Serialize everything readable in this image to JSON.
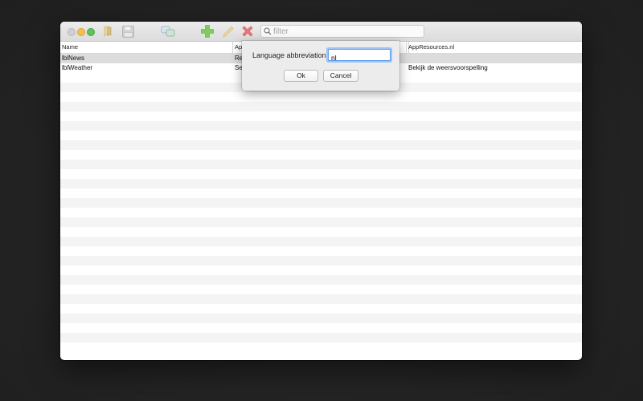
{
  "toolbar": {
    "search_placeholder": "filter",
    "icons": [
      "bookmark-icon",
      "save-icon",
      "translate-icon",
      "add-icon",
      "edit-icon",
      "delete-icon",
      "search-icon"
    ]
  },
  "table": {
    "columns": [
      "Name",
      "Ap",
      "",
      "AppResources.nl"
    ],
    "rows": [
      {
        "name": "lblNews",
        "app": "Re",
        "col3": "",
        "nl": ""
      },
      {
        "name": "lblWeather",
        "app": "Se",
        "col3": "",
        "nl": "Bekijk de weersvoorspelling"
      }
    ]
  },
  "dialog": {
    "label": "Language abbreviation",
    "value": "nl",
    "ok_label": "Ok",
    "cancel_label": "Cancel"
  },
  "colors": {
    "desktop": "#232323",
    "close": "#cfcfcf",
    "minimize": "#f4bf4f",
    "maximize": "#5fc454",
    "add": "#6cc04a",
    "delete": "#e05555",
    "focus_ring": "#5d9cec"
  }
}
